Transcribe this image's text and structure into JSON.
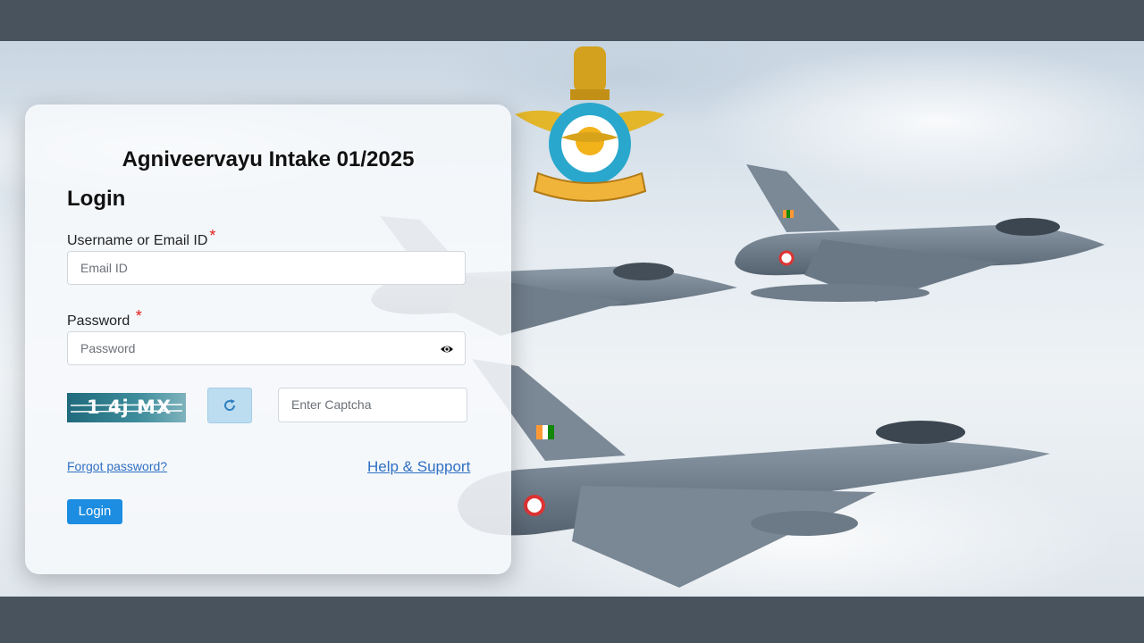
{
  "app": {
    "title": "Agniveervayu Intake 01/2025"
  },
  "login": {
    "heading": "Login",
    "username_label": "Username or Email ID",
    "username_placeholder": "Email ID",
    "password_label": "Password",
    "password_placeholder": "Password",
    "required_mark": "*",
    "captcha_text": "1 4j MX",
    "captcha_placeholder": "Enter Captcha",
    "forgot_password": "Forgot password?",
    "help_support": "Help & Support",
    "login_button": "Login"
  },
  "icons": {
    "show_password": "eye-icon",
    "refresh_captcha": "refresh-icon",
    "emblem": "iaf-emblem-icon"
  },
  "colors": {
    "accent": "#1d8de1",
    "link": "#2f6fc4",
    "required": "#e0201c",
    "frame": "#48535e"
  }
}
